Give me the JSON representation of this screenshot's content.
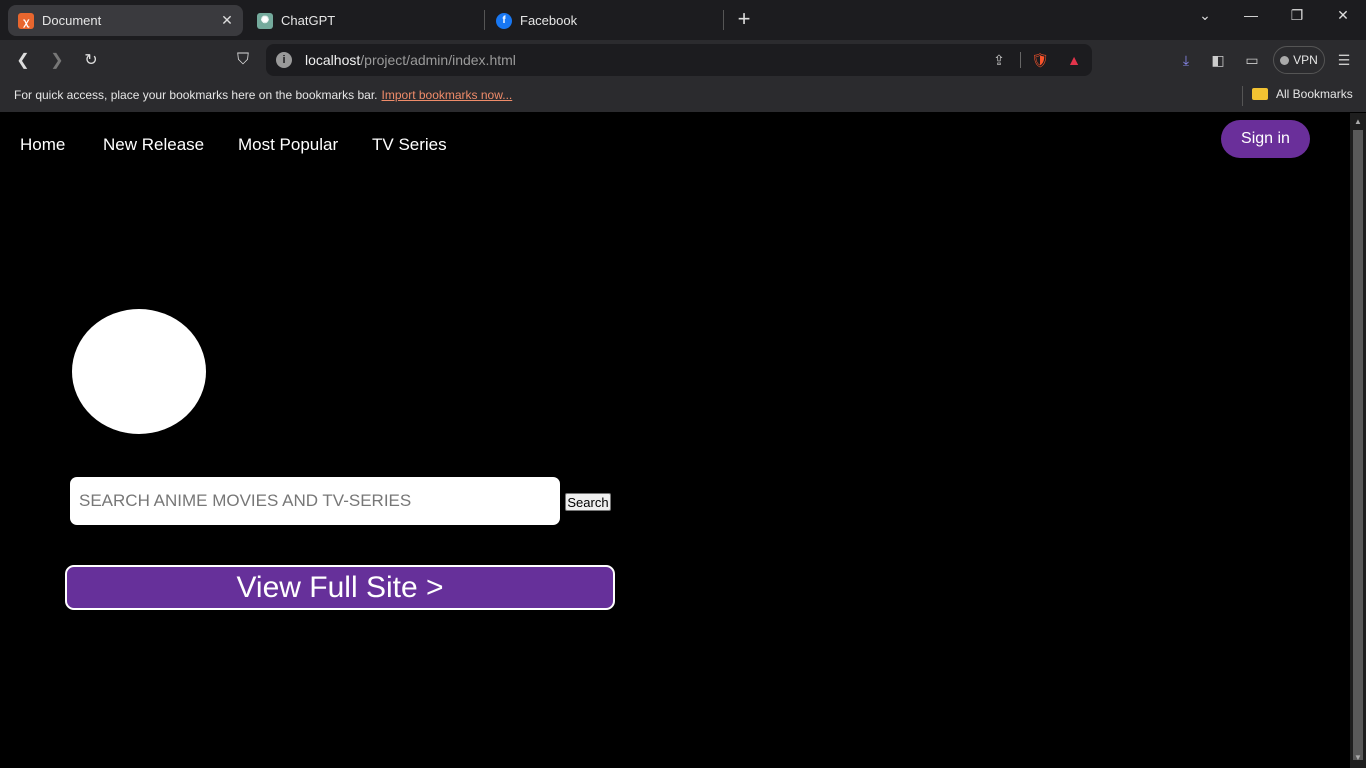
{
  "tabs": [
    {
      "label": "Document",
      "favicon": "xampp-icon"
    },
    {
      "label": "ChatGPT",
      "favicon": "chatgpt-icon"
    },
    {
      "label": "Facebook",
      "favicon": "facebook-icon"
    }
  ],
  "address": {
    "host": "localhost",
    "path": "/project/admin/index.html"
  },
  "bookmarks_bar": {
    "message": "For quick access, place your bookmarks here on the bookmarks bar.",
    "import_link": "Import bookmarks now...",
    "all_bookmarks": "All Bookmarks"
  },
  "vpn_label": "VPN",
  "site": {
    "nav": [
      "Home",
      "New Release",
      "Most Popular",
      "TV Series"
    ],
    "signin": "Sign in",
    "search_placeholder": "SEARCH ANIME MOVIES AND TV-SERIES",
    "search_button": "Search",
    "full_site_button": "View Full Site >"
  },
  "colors": {
    "accent": "#66309a",
    "background": "#000000",
    "chrome": "#2b2b2e"
  }
}
